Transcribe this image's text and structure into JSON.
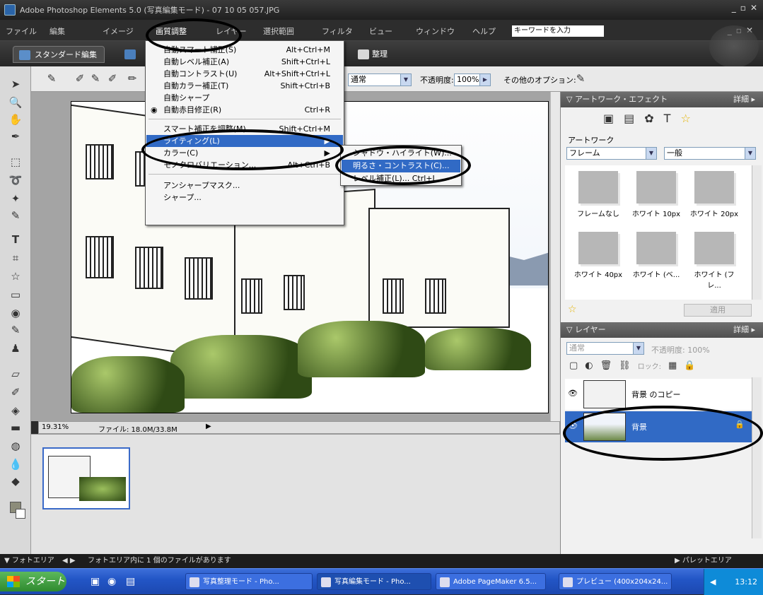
{
  "window": {
    "title": "Adobe Photoshop Elements 5.0 (写真編集モード) - 07 10 05 057.JPG"
  },
  "menu": [
    "ファイル",
    "編集",
    "イメージ",
    "画質調整",
    "レイヤー",
    "選択範囲",
    "フィルタ",
    "ビュー",
    "ウィンドウ",
    "ヘルプ"
  ],
  "search": {
    "placeholder": "キーワードを入力"
  },
  "tabs": {
    "standard": "スタンダード編集",
    "organize": "整理"
  },
  "options": {
    "mode": "通常",
    "opacity_label": "不透明度:",
    "opacity_value": "100%",
    "other": "その他のオプション:"
  },
  "dropdown": {
    "items": [
      {
        "label": "自動スマート補正(S)",
        "shortcut": "Alt+Ctrl+M"
      },
      {
        "label": "自動レベル補正(A)",
        "shortcut": "Shift+Ctrl+L"
      },
      {
        "label": "自動コントラスト(U)",
        "shortcut": "Alt+Shift+Ctrl+L"
      },
      {
        "label": "自動カラー補正(T)",
        "shortcut": "Shift+Ctrl+B"
      },
      {
        "label": "自動シャープ",
        "shortcut": ""
      },
      {
        "label": "自動赤目修正(R)",
        "shortcut": "Ctrl+R"
      },
      {
        "label": "スマート補正を調整(M)...",
        "shortcut": "Shift+Ctrl+M"
      },
      {
        "label": "ライティング(L)",
        "shortcut": ""
      },
      {
        "label": "カラー(C)",
        "shortcut": ""
      },
      {
        "label": "モノクロバリエーション...",
        "shortcut": "Alt+Ctrl+B"
      },
      {
        "label": "アンシャープマスク...",
        "shortcut": ""
      },
      {
        "label": "シャープ...",
        "shortcut": ""
      }
    ]
  },
  "submenu": {
    "items": [
      "シャドウ・ハイライト(W)...",
      "明るさ・コントラスト(C)...",
      "レベル補正(L)...     Ctrl+L"
    ]
  },
  "status": {
    "zoom": "19.31%",
    "file": "ファイル: 18.0M/33.8M"
  },
  "artwork": {
    "header": "アートワーク・エフェクト",
    "more": "詳細 ▸",
    "section": "アートワーク",
    "category": "フレーム",
    "subcategory": "一般",
    "apply": "適用",
    "items": [
      "フレームなし",
      "ホワイト 10px",
      "ホワイト 20px",
      "ホワイト 40px",
      "ホワイト (ベ...",
      "ホワイト (フレ..."
    ]
  },
  "layers": {
    "header": "レイヤー",
    "more": "詳細 ▸",
    "mode": "通常",
    "opacity": "不透明度: 100%",
    "lock": "ロック:",
    "items": [
      {
        "name": "背景 のコピー"
      },
      {
        "name": "背景"
      }
    ]
  },
  "bottombar": {
    "left": "▼ フォトエリア",
    "message": "フォトエリア内に 1 個のファイルがあります",
    "right": "▶ パレットエリア"
  },
  "taskbar": {
    "start": "スタート",
    "items": [
      "写真整理モード - Pho...",
      "写真編集モード - Pho...",
      "Adobe PageMaker 6.5...",
      "プレビュー (400x204x24..."
    ],
    "time": "13:12"
  }
}
